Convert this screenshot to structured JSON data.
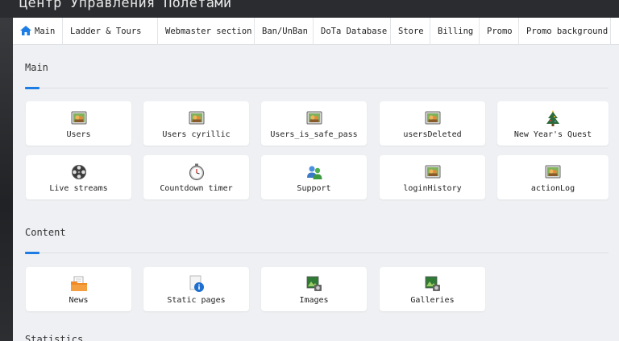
{
  "page": {
    "title": "Центр Управления Полетами"
  },
  "nav": {
    "items": [
      {
        "label": "Main",
        "icon": "home-icon"
      },
      {
        "label": "Ladder & Tours"
      },
      {
        "label": "Webmaster section"
      },
      {
        "label": "Ban/UnBan"
      },
      {
        "label": "DoTa Database"
      },
      {
        "label": "Store"
      },
      {
        "label": "Billing"
      },
      {
        "label": "Promo"
      },
      {
        "label": "Promo background"
      }
    ]
  },
  "sections": {
    "main": {
      "title": "Main",
      "tiles": [
        {
          "label": "Users",
          "icon": "user-picture-icon"
        },
        {
          "label": "Users cyrillic",
          "icon": "user-picture-icon"
        },
        {
          "label": "Users_is_safe_pass",
          "icon": "user-picture-icon"
        },
        {
          "label": "usersDeleted",
          "icon": "user-picture-icon"
        },
        {
          "label": "New Year's Quest",
          "icon": "christmas-tree-icon"
        },
        {
          "label": "Live streams",
          "icon": "film-reel-icon"
        },
        {
          "label": "Countdown timer",
          "icon": "stopwatch-icon"
        },
        {
          "label": "Support",
          "icon": "support-people-icon"
        },
        {
          "label": "loginHistory",
          "icon": "user-picture-icon"
        },
        {
          "label": "actionLog",
          "icon": "user-picture-icon"
        }
      ]
    },
    "content": {
      "title": "Content",
      "tiles": [
        {
          "label": "News",
          "icon": "news-folder-icon"
        },
        {
          "label": "Static pages",
          "icon": "info-page-icon"
        },
        {
          "label": "Images",
          "icon": "image-icon"
        },
        {
          "label": "Galleries",
          "icon": "gallery-icon"
        }
      ]
    },
    "statistics": {
      "title": "Statistics"
    }
  },
  "colors": {
    "accent": "#1e7de4",
    "panel": "#eef0f3",
    "tile": "#ffffff",
    "frame": "#2a2c2f"
  }
}
